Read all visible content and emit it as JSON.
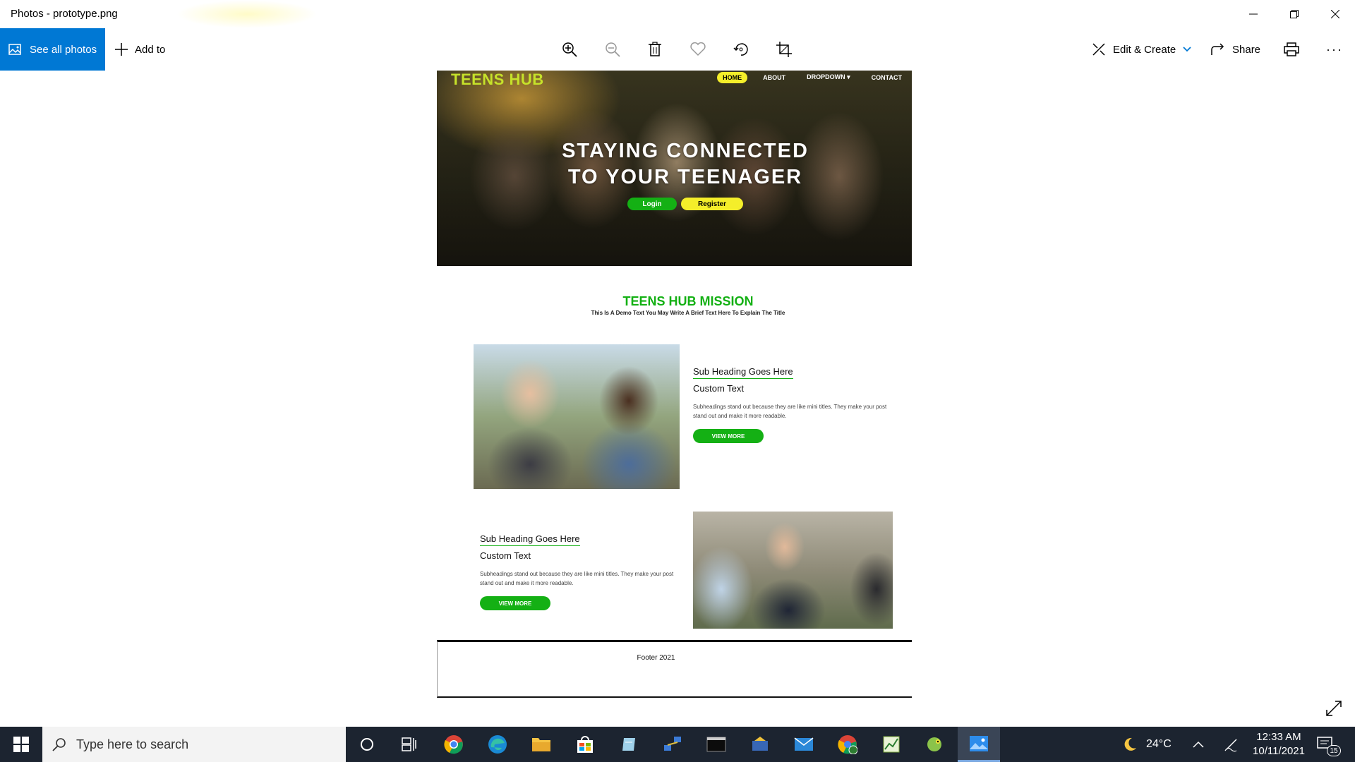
{
  "window": {
    "title": "Photos - prototype.png"
  },
  "toolbar": {
    "see_all_label": "See all photos",
    "add_to_label": "Add to",
    "edit_create_label": "Edit & Create",
    "share_label": "Share",
    "more_label": "···"
  },
  "prototype": {
    "brand": "TEENS HUB",
    "nav": [
      "HOME",
      "ABOUT",
      "DROPDOWN ▾",
      "CONTACT"
    ],
    "hero_line1": "STAYING CONNECTED",
    "hero_line2": "TO YOUR TEENAGER",
    "login_label": "Login",
    "register_label": "Register",
    "mission_title": "TEENS HUB MISSION",
    "mission_subtitle": "This Is A Demo Text You May Write A Brief Text Here To Explain The Title",
    "sections": [
      {
        "sub_heading": "Sub Heading Goes Here",
        "custom_text": "Custom Text",
        "body": "Subheadings stand out because they are like mini titles. They make your post stand out and make it more readable.",
        "button": "VIEW MORE"
      },
      {
        "sub_heading": "Sub Heading Goes Here",
        "custom_text": "Custom Text",
        "body": "Subheadings stand out because they are like mini titles. They make your post stand out and make it more readable.",
        "button": "VIEW MORE"
      }
    ],
    "footer": "Footer 2021"
  },
  "taskbar": {
    "search_placeholder": "Type here to search",
    "weather": "24°C",
    "time": "12:33 AM",
    "date": "10/11/2021",
    "notifications": "15"
  },
  "colors": {
    "accent_blue": "#0078d4",
    "brand_green": "#13b013",
    "brand_yellow": "#f4ee2a",
    "taskbar": "#1c2430"
  }
}
